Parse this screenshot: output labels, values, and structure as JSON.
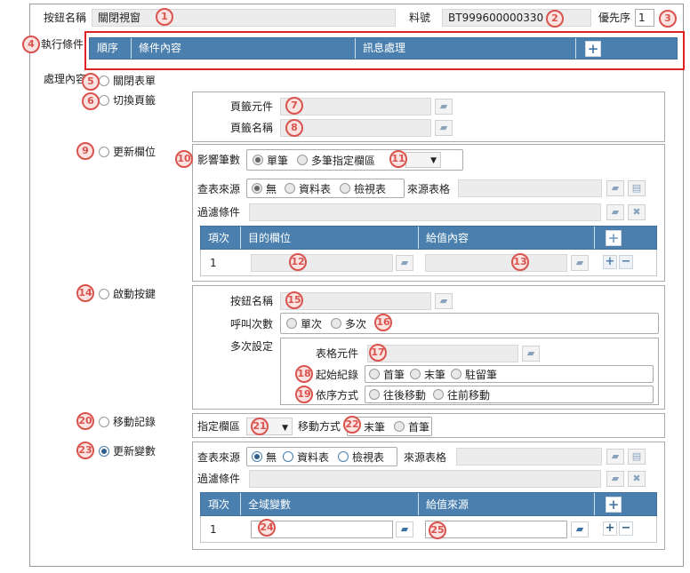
{
  "colors": {
    "accent": "#4a7fae",
    "badge": "#d9534f",
    "highlight_border": "#e02222"
  },
  "badges": [
    "1",
    "2",
    "3",
    "4",
    "5",
    "6",
    "7",
    "8",
    "9",
    "10",
    "11",
    "12",
    "13",
    "14",
    "15",
    "16",
    "17",
    "18",
    "19",
    "20",
    "21",
    "22",
    "23",
    "24",
    "25"
  ],
  "top": {
    "button_name_label": "按鈕名稱",
    "button_name_value": "關閉視窗",
    "part_no_label": "料號",
    "part_no_value": "BT999600000330",
    "priority_label": "優先序",
    "priority_value": "1"
  },
  "exec_conditions": {
    "label": "執行條件",
    "columns": [
      "順序",
      "條件內容",
      "訊息處理"
    ],
    "add": "+"
  },
  "processing": {
    "label": "處理內容"
  },
  "options": {
    "close_form": "關閉表單",
    "switch_tab": "切換頁籤",
    "update_field": "更新欄位",
    "trigger_button": "啟動按鍵",
    "move_record": "移動記錄",
    "update_variable": "更新變數"
  },
  "switch_tab_panel": {
    "tab_element_label": "頁籤元件",
    "tab_name_label": "頁籤名稱"
  },
  "update_field_panel": {
    "affected_label": "影響筆數",
    "single": "單筆",
    "multi": "多筆指定欄區",
    "source_label": "查表來源",
    "none": "無",
    "data_table": "資料表",
    "view_table": "檢視表",
    "source_table_label": "來源表格",
    "filter_label": "過濾條件",
    "columns": [
      "項次",
      "目的欄位",
      "給值內容"
    ],
    "row_no": "1"
  },
  "trigger_panel": {
    "button_name_label": "按鈕名稱",
    "call_count_label": "呼叫次數",
    "once": "單次",
    "multiple": "多次",
    "multi_settings_label": "多次設定",
    "grid_element_label": "表格元件",
    "start_record_label": "起始紀錄",
    "first": "首筆",
    "last": "末筆",
    "stay": "駐留筆",
    "order_label": "依序方式",
    "forward": "往後移動",
    "backward": "往前移動"
  },
  "move_record_panel": {
    "zone_label": "指定欄區",
    "method_label": "移動方式",
    "last": "末筆",
    "first": "首筆"
  },
  "update_variable_panel": {
    "source_label": "查表來源",
    "none": "無",
    "data_table": "資料表",
    "view_table": "檢視表",
    "source_table_label": "來源表格",
    "filter_label": "過濾條件",
    "columns": [
      "項次",
      "全域變數",
      "給值來源"
    ],
    "row_no": "1"
  },
  "icons": {
    "folder": "folder-open-icon",
    "add": "plus-icon",
    "remove": "minus-icon",
    "delete": "delete-icon",
    "clear": "trash-icon",
    "dropdown": "caret-down-icon"
  }
}
